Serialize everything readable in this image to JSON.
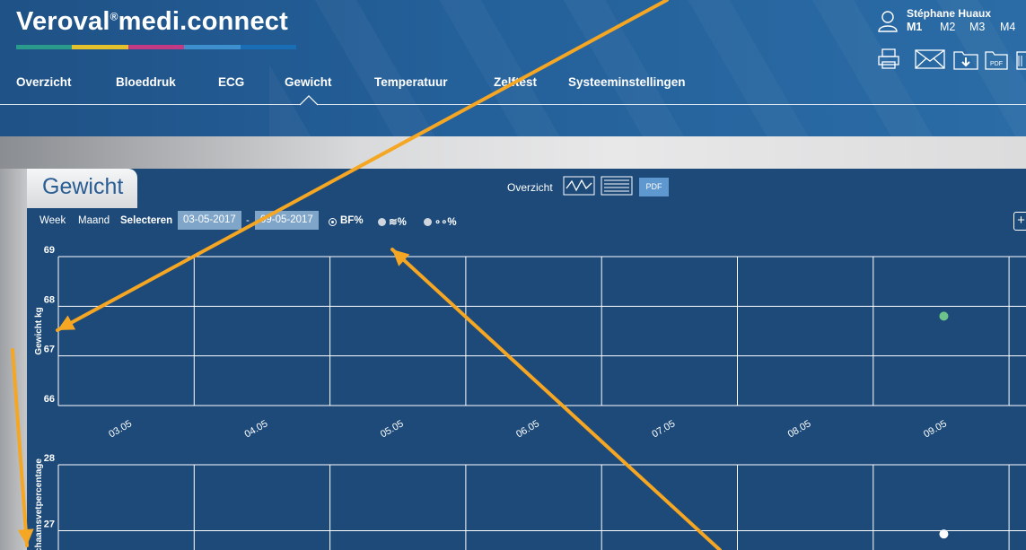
{
  "app": {
    "brand": "Veroval",
    "brand_rest": "medi.connect",
    "color_bar": [
      "#2a9a8c",
      "#e2c12d",
      "#c23a84",
      "#3d8fcd",
      "#1a6eb5"
    ]
  },
  "nav": {
    "items": [
      {
        "label": "Overzicht"
      },
      {
        "label": "Bloeddruk"
      },
      {
        "label": "ECG"
      },
      {
        "label": "Gewicht"
      },
      {
        "label": "Temperatuur"
      },
      {
        "label": "Zelftest"
      },
      {
        "label": "Systeeminstellingen"
      }
    ],
    "active": "Gewicht"
  },
  "user": {
    "name": "Stéphane Huaux",
    "memories": [
      "M1",
      "M2",
      "M3",
      "M4"
    ],
    "active_memory": "M1",
    "tools": [
      "printer-icon",
      "mail-icon",
      "download-folder-icon",
      "pdf-icon",
      "more-icon"
    ]
  },
  "panel": {
    "title": "Gewicht",
    "overview_label": "Overzicht",
    "view_icons": [
      "line-chart-icon",
      "table-icon"
    ],
    "pdf_label": "PDF",
    "plus_label": "+",
    "range_week": "Week",
    "range_month": "Maand",
    "select_label": "Selecteren",
    "date_from": "03-05-2017",
    "date_sep": "-",
    "date_to": "09-05-2017",
    "radios": [
      {
        "label": "BF%",
        "selected": true
      },
      {
        "label": "≋%",
        "selected": false
      },
      {
        "label": "∘∘%",
        "selected": false
      }
    ]
  },
  "chart_data": [
    {
      "type": "scatter",
      "ylabel": "Gewicht kg",
      "yticks": [
        69,
        68,
        67,
        66
      ],
      "ylim": [
        66,
        69
      ],
      "categories": [
        "03.05",
        "04.05",
        "05.05",
        "06.05",
        "07.05",
        "08.05",
        "09.05"
      ],
      "series": [
        {
          "values": [
            null,
            null,
            null,
            null,
            null,
            null,
            67.8
          ],
          "color": "#6cc48a"
        }
      ]
    },
    {
      "type": "scatter",
      "ylabel": "Lichaamsvetpercentage",
      "yticks": [
        28,
        27
      ],
      "ylim": [
        26,
        28
      ],
      "categories": [
        "03.05",
        "04.05",
        "05.05",
        "06.05",
        "07.05",
        "08.05",
        "09.05"
      ],
      "series": [
        {
          "values": [
            null,
            null,
            null,
            null,
            null,
            null,
            26.95
          ],
          "color": "#ffffff"
        }
      ]
    }
  ],
  "overlay_color": "#f5a623"
}
